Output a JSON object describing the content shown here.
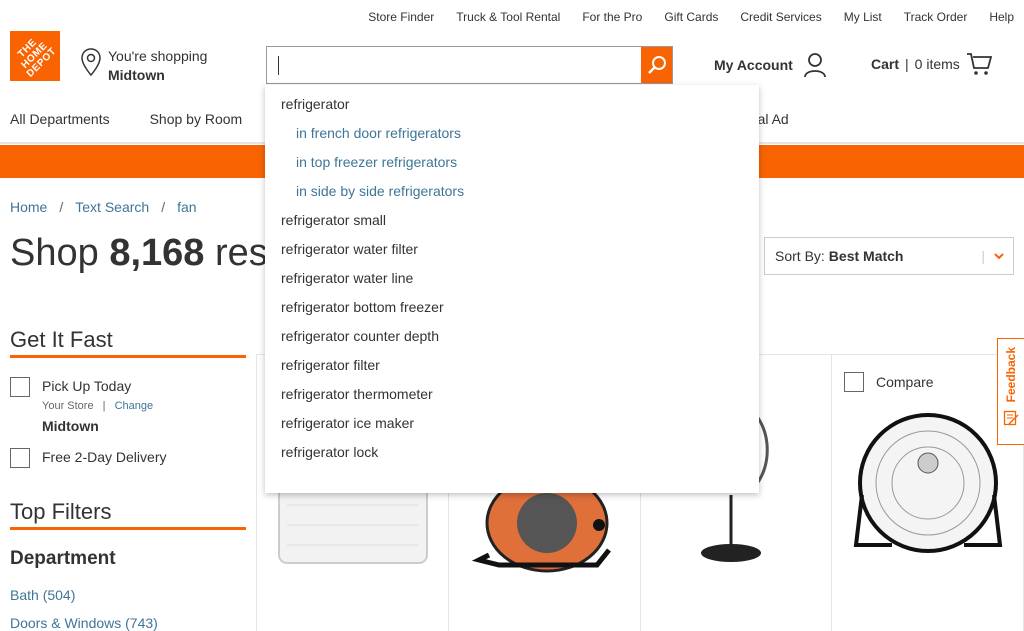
{
  "util_nav": [
    "Store Finder",
    "Truck & Tool Rental",
    "For the Pro",
    "Gift Cards",
    "Credit Services",
    "My List",
    "Track Order",
    "Help"
  ],
  "logo_text": "THE HOME DEPOT",
  "store": {
    "line1": "You're shopping",
    "name": "Midtown"
  },
  "search": {
    "value": "",
    "placeholder": ""
  },
  "account": "My Account",
  "cart": {
    "label": "Cart",
    "sep": "|",
    "items": "0 items"
  },
  "dept_nav": [
    "All Departments",
    "Shop by Room"
  ],
  "dept_nav_right": "Local Ad",
  "breadcrumb": [
    "Home",
    "Text Search",
    "fan"
  ],
  "title": {
    "prefix": "Shop",
    "count": "8,168",
    "suffix": "results"
  },
  "sort": {
    "label": "Sort By:",
    "value": "Best Match"
  },
  "filters": {
    "get_it_fast": "Get It Fast",
    "pickup": "Pick Up Today",
    "your_store": "Your Store",
    "change": "Change",
    "store_name": "Midtown",
    "delivery": "Free 2-Day Delivery",
    "top_filters": "Top Filters",
    "department": "Department",
    "dept_items": [
      "Bath (504)",
      "Doors & Windows (743)"
    ]
  },
  "compare": "Compare",
  "feedback": "Feedback",
  "suggestions": [
    {
      "text": "refrigerator",
      "sub": false
    },
    {
      "text": "in french door refrigerators",
      "sub": true
    },
    {
      "text": "in top freezer refrigerators",
      "sub": true
    },
    {
      "text": "in side by side refrigerators",
      "sub": true
    },
    {
      "text": "refrigerator small",
      "sub": false
    },
    {
      "text": "refrigerator water filter",
      "sub": false
    },
    {
      "text": "refrigerator water line",
      "sub": false
    },
    {
      "text": "refrigerator bottom freezer",
      "sub": false
    },
    {
      "text": "refrigerator counter depth",
      "sub": false
    },
    {
      "text": "refrigerator filter",
      "sub": false
    },
    {
      "text": "refrigerator thermometer",
      "sub": false
    },
    {
      "text": "refrigerator ice maker",
      "sub": false
    },
    {
      "text": "refrigerator lock",
      "sub": false
    }
  ],
  "colors": {
    "brand_orange": "#f96302",
    "link_blue": "#3e7697"
  }
}
